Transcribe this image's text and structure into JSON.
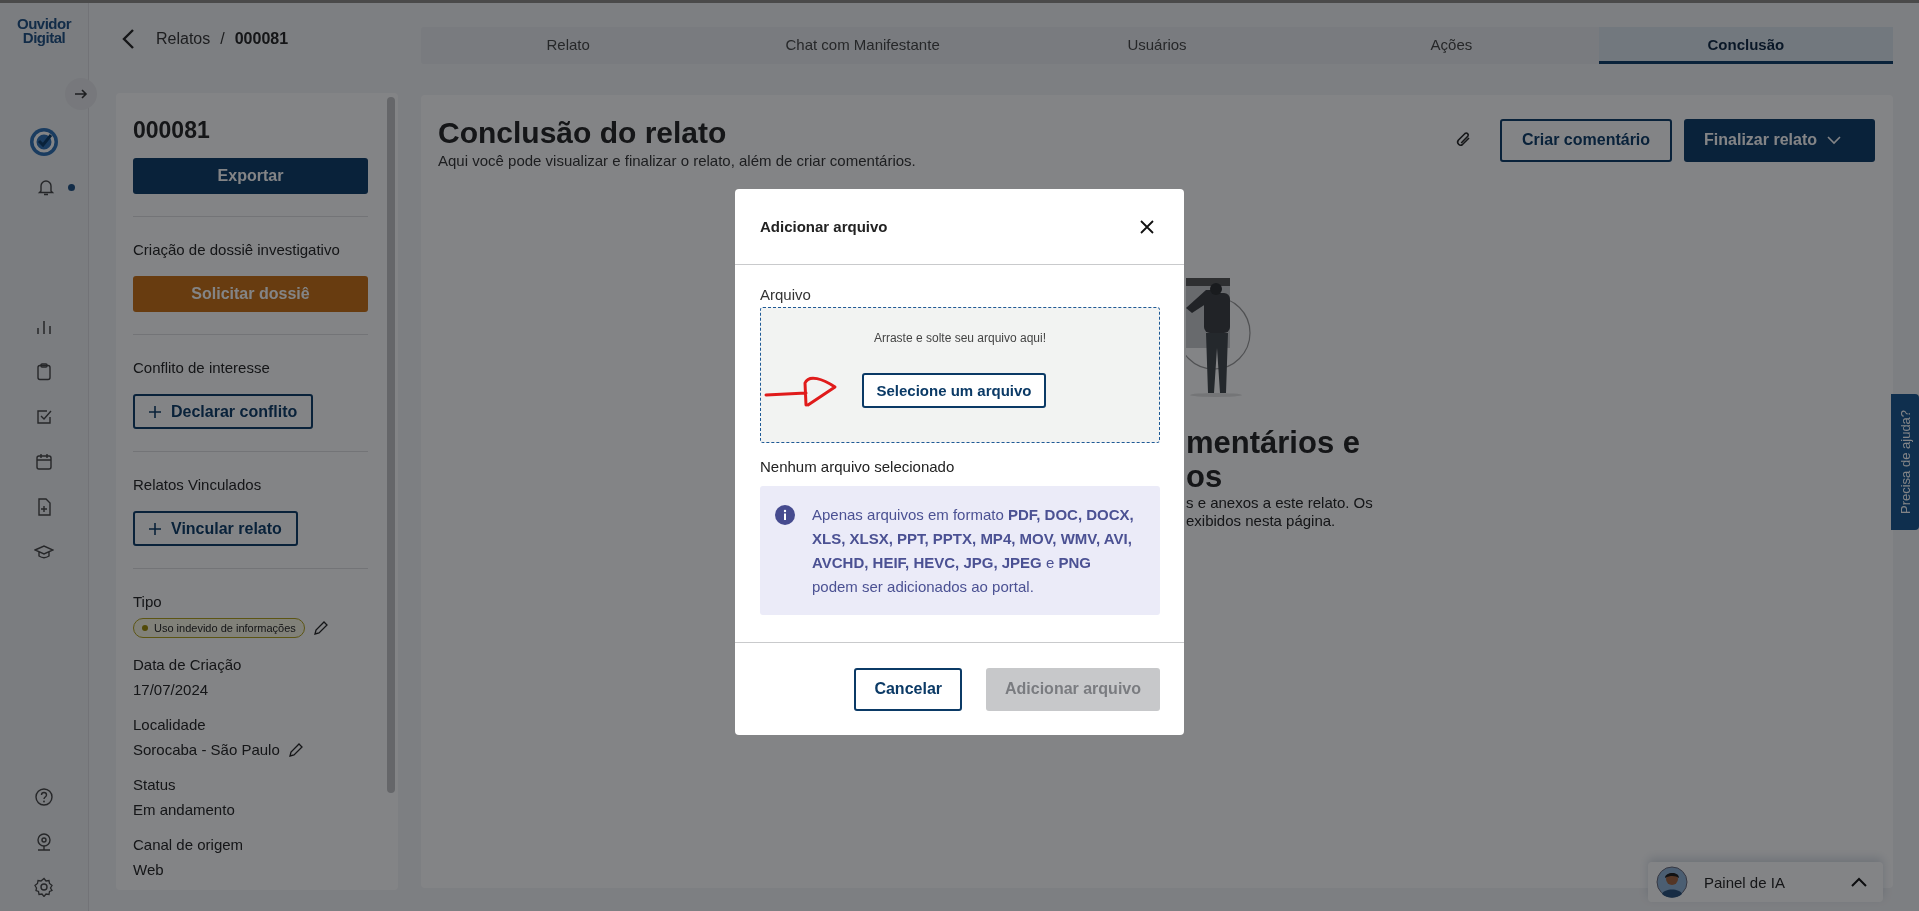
{
  "logo": {
    "line1": "Ouvidor",
    "line2": "Digital"
  },
  "nav": {
    "notification": true
  },
  "breadcrumb": {
    "parent": "Relatos",
    "separator": "/",
    "current": "000081"
  },
  "tabs": [
    {
      "label": "Relato",
      "selected": false
    },
    {
      "label": "Chat com Manifestante",
      "selected": false
    },
    {
      "label": "Usuários",
      "selected": false
    },
    {
      "label": "Ações",
      "selected": false
    },
    {
      "label": "Conclusão",
      "selected": true
    }
  ],
  "report": {
    "id": "000081",
    "export_button": "Exportar",
    "sections": [
      {
        "title": "Criação de dossiê investigativo",
        "button": "Solicitar dossiê",
        "kind": "primary"
      },
      {
        "title": "Conflito de interesse",
        "button": "Declarar conflito",
        "kind": "add"
      },
      {
        "title": "Relatos Vinculados",
        "button": "Vincular relato",
        "kind": "add"
      }
    ],
    "fields": [
      {
        "label": "Tipo",
        "value": "Uso indevido de informações",
        "kind": "tag",
        "editable": true
      },
      {
        "label": "Data de Criação",
        "value": "17/07/2024",
        "kind": "text",
        "editable": false
      },
      {
        "label": "Localidade",
        "value": "Sorocaba - São Paulo",
        "kind": "text",
        "editable": true
      },
      {
        "label": "Status",
        "value": "Em andamento",
        "kind": "text",
        "editable": false
      },
      {
        "label": "Canal de origem",
        "value": "Web",
        "kind": "text",
        "editable": false
      }
    ]
  },
  "content": {
    "title": "Conclusão do relato",
    "subtitle": "Aqui você pode visualizar e finalizar o relato, além de criar comentários.",
    "comment_button": "Criar comentário",
    "finish_button": "Finalizar relato",
    "empty_state": {
      "heading_lines": [
        "mentários e",
        "os"
      ],
      "text_lines": [
        "s e anexos a este relato. Os",
        "exibidos nesta página."
      ]
    }
  },
  "modal": {
    "title": "Adicionar arquivo",
    "field_label": "Arquivo",
    "drop_hint": "Arraste e solte seu arquivo aqui!",
    "select_button": "Selecione um arquivo",
    "status": "Nenhum arquivo selecionado",
    "info": "Apenas arquivos em formato **PDF, DOC, DOCX, XLS, XLSX, PPT, PPTX, MP4, MOV, WMV, AVI, AVCHD, HEIF, HEVC, JPG, JPEG** e **PNG** podem ser adicionados ao portal.",
    "cancel_button": "Cancelar",
    "add_button": {
      "label": "Adicionar arquivo",
      "disabled": true
    }
  },
  "help_tab": "Precisa de ajuda?",
  "ai_panel": {
    "label": "Painel de IA",
    "expanded": false
  }
}
